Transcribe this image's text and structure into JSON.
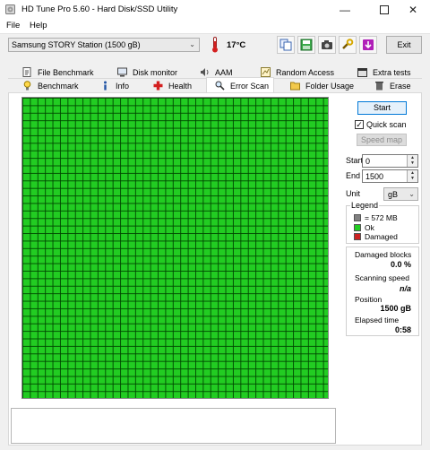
{
  "window": {
    "title": "HD Tune Pro 5.60 - Hard Disk/SSD Utility"
  },
  "menu": {
    "file": "File",
    "help": "Help"
  },
  "toolbar": {
    "drive": "Samsung STORY Station (1500 gB)",
    "temperature": "17°C",
    "exit_label": "Exit",
    "icons": [
      "copy-icon",
      "save-icon",
      "camera-icon",
      "options-icon",
      "download-icon"
    ]
  },
  "tabs": {
    "row1": [
      "File Benchmark",
      "Disk monitor",
      "AAM",
      "Random Access",
      "Extra tests"
    ],
    "row2": [
      "Benchmark",
      "Info",
      "Health",
      "Error Scan",
      "Folder Usage",
      "Erase"
    ],
    "active": "Error Scan"
  },
  "controls": {
    "start_button": "Start",
    "quick_scan_label": "Quick scan",
    "quick_scan_checked": true,
    "speed_map_button": "Speed map",
    "start_label": "Start",
    "start_value": "0",
    "end_label": "End",
    "end_value": "1500",
    "unit_label": "Unit",
    "unit_value": "gB"
  },
  "legend": {
    "title": "Legend",
    "items": [
      {
        "label": "= 572 MB",
        "color": "#808080"
      },
      {
        "label": "Ok",
        "color": "#22cc22"
      },
      {
        "label": "Damaged",
        "color": "#cc2222"
      }
    ]
  },
  "stats": {
    "damaged_blocks_label": "Damaged blocks",
    "damaged_blocks_value": "0.0 %",
    "scanning_speed_label": "Scanning speed",
    "scanning_speed_value": "n/a",
    "position_label": "Position",
    "position_value": "1500 gB",
    "elapsed_label": "Elapsed time",
    "elapsed_value": "0:58"
  },
  "colors": {
    "ok_block": "#22cc22",
    "grid_line": "#004600",
    "accent": "#0078d7"
  }
}
